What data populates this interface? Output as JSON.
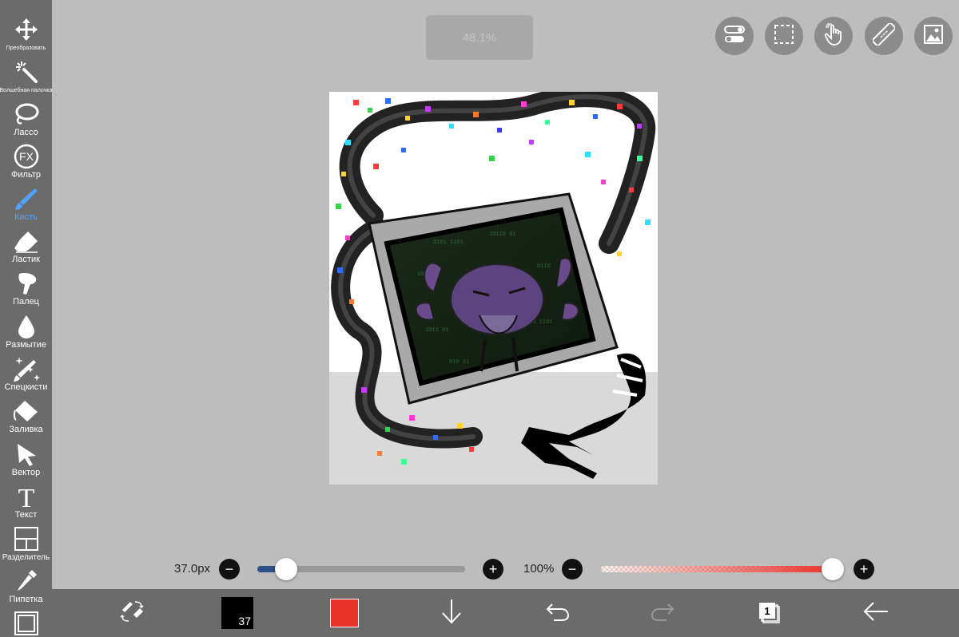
{
  "left_toolbar": {
    "tools": [
      {
        "id": "transform",
        "label": "Преобразовать",
        "icon": "move-arrows-icon"
      },
      {
        "id": "magic-wand",
        "label": "Волшебная палочка",
        "icon": "magic-wand-icon"
      },
      {
        "id": "lasso",
        "label": "Лассо",
        "icon": "lasso-icon"
      },
      {
        "id": "filter",
        "label": "Фильтр",
        "icon": "fx-icon"
      },
      {
        "id": "brush",
        "label": "Кисть",
        "icon": "brush-icon",
        "active": true
      },
      {
        "id": "eraser",
        "label": "Ластик",
        "icon": "eraser-icon"
      },
      {
        "id": "finger",
        "label": "Палец",
        "icon": "smudge-finger-icon"
      },
      {
        "id": "blur",
        "label": "Размытие",
        "icon": "droplet-icon"
      },
      {
        "id": "special-brush",
        "label": "Спецкисти",
        "icon": "sparkle-brush-icon"
      },
      {
        "id": "fill",
        "label": "Заливка",
        "icon": "paint-bucket-icon"
      },
      {
        "id": "vector",
        "label": "Вектор",
        "icon": "cursor-arrow-icon"
      },
      {
        "id": "text",
        "label": "Текст",
        "icon": "text-t-icon"
      },
      {
        "id": "divider",
        "label": "Разделитель",
        "icon": "frame-divider-icon"
      },
      {
        "id": "eyedropper",
        "label": "Пипетка",
        "icon": "eyedropper-icon"
      },
      {
        "id": "canvas",
        "label": "",
        "icon": "canvas-frame-icon"
      }
    ]
  },
  "zoom_indicator": "48.1%",
  "top_right_buttons": [
    {
      "id": "toggle-settings",
      "icon": "toggle-switches-icon"
    },
    {
      "id": "selection",
      "icon": "dashed-selection-icon"
    },
    {
      "id": "touch",
      "icon": "hand-touch-icon"
    },
    {
      "id": "ruler",
      "icon": "ruler-icon"
    },
    {
      "id": "image",
      "icon": "image-gallery-icon"
    }
  ],
  "brush_size": {
    "label": "37.0px",
    "value_fraction": 0.14
  },
  "opacity": {
    "label": "100%",
    "value_fraction": 1.0
  },
  "bottom_toolbar": {
    "brush_preview_size": "37",
    "primary_color": "#e8332a",
    "layers_count": "1"
  },
  "colors": {
    "toolbar_bg": "#6b6b6b",
    "app_bg": "#bdbdbd",
    "accent_blue": "#4fa3ff",
    "slider_blue": "#2e5288",
    "opacity_red": "#e8332a"
  }
}
